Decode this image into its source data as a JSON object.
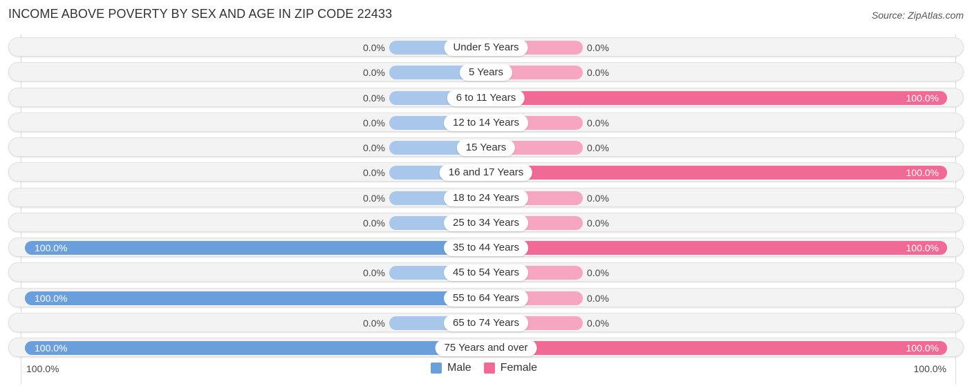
{
  "header": {
    "title": "INCOME ABOVE POVERTY BY SEX AND AGE IN ZIP CODE 22433",
    "source": "Source: ZipAtlas.com"
  },
  "colors": {
    "male": "#6a9fdb",
    "male_light": "#a9c7ea",
    "female": "#f06a95",
    "female_light": "#f6a6c0",
    "track": "#f3f3f3"
  },
  "chart_data": {
    "type": "bar",
    "orientation": "horizontal-diverging",
    "title": "INCOME ABOVE POVERTY BY SEX AND AGE IN ZIP CODE 22433",
    "categories": [
      "Under 5 Years",
      "5 Years",
      "6 to 11 Years",
      "12 to 14 Years",
      "15 Years",
      "16 and 17 Years",
      "18 to 24 Years",
      "25 to 34 Years",
      "35 to 44 Years",
      "45 to 54 Years",
      "55 to 64 Years",
      "65 to 74 Years",
      "75 Years and over"
    ],
    "series": [
      {
        "name": "Male",
        "values": [
          0,
          0,
          0,
          0,
          0,
          0,
          0,
          0,
          100,
          0,
          100,
          0,
          100
        ],
        "labels": [
          "0.0%",
          "0.0%",
          "0.0%",
          "0.0%",
          "0.0%",
          "0.0%",
          "0.0%",
          "0.0%",
          "100.0%",
          "0.0%",
          "100.0%",
          "0.0%",
          "100.0%"
        ]
      },
      {
        "name": "Female",
        "values": [
          0,
          0,
          100,
          0,
          0,
          100,
          0,
          0,
          100,
          0,
          0,
          0,
          100
        ],
        "labels": [
          "0.0%",
          "0.0%",
          "100.0%",
          "0.0%",
          "0.0%",
          "100.0%",
          "0.0%",
          "0.0%",
          "100.0%",
          "0.0%",
          "0.0%",
          "0.0%",
          "100.0%"
        ]
      }
    ],
    "xlim": [
      0,
      100
    ],
    "axis_labels": {
      "left": "100.0%",
      "right": "100.0%"
    },
    "legend": {
      "position": "bottom-center",
      "entries": [
        "Male",
        "Female"
      ]
    },
    "units": "%"
  }
}
